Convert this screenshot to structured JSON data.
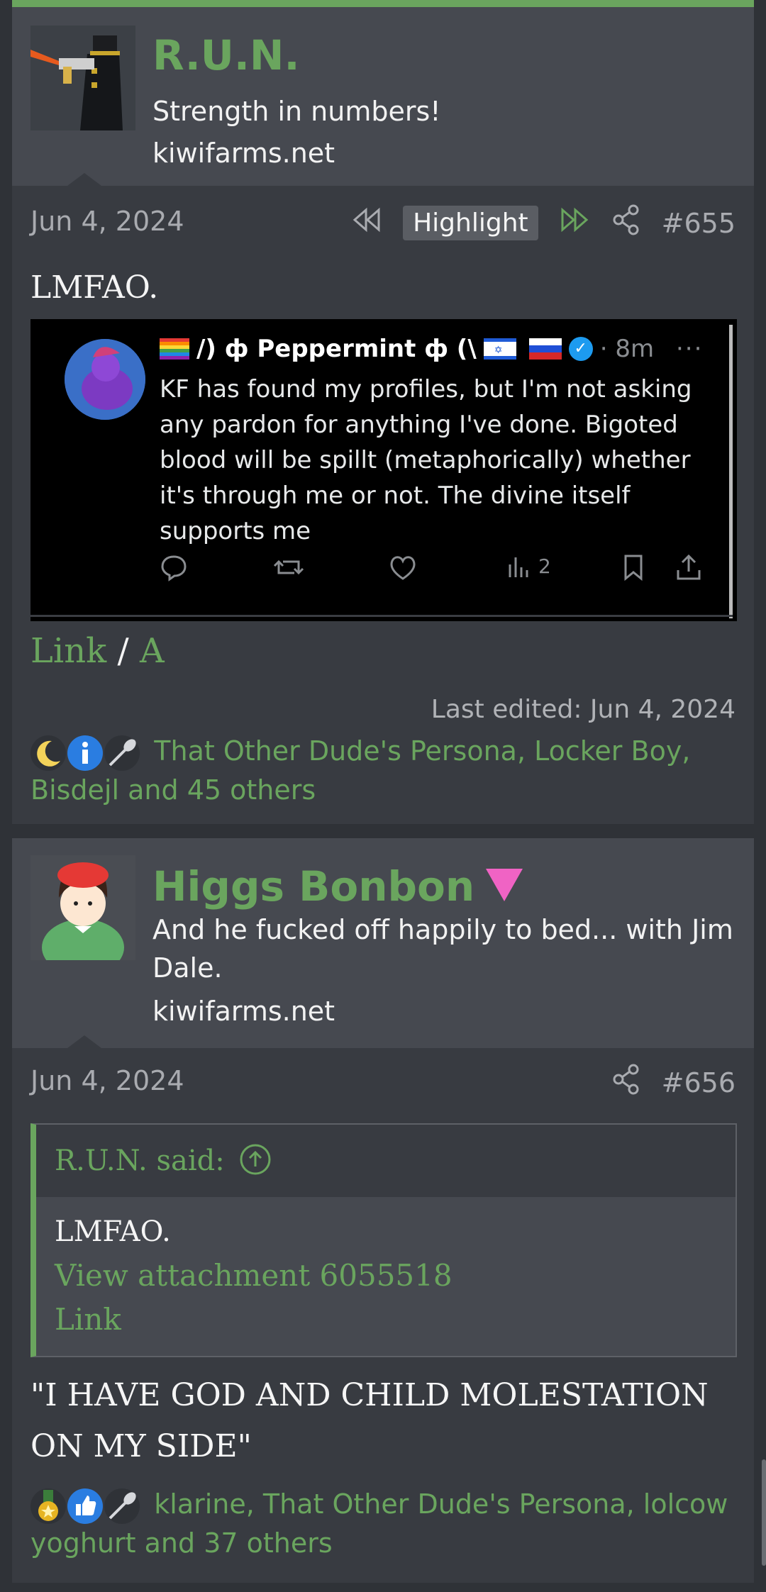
{
  "post1": {
    "username": "R.U.N.",
    "user_title": "Strength in numbers!",
    "user_site": "kiwifarms.net",
    "date": "Jun 4, 2024",
    "highlight_label": "Highlight",
    "post_number": "#655",
    "body": "LMFAO.",
    "embed": {
      "display_name": "/) ф Peppermint ф (\\",
      "time": "· 8m",
      "text": "KF has found my profiles, but I'm not asking any pardon for anything I've done. Bigoted blood will be spillt (metaphorically) whether it's through me or not. The divine itself supports me",
      "view_count": "2"
    },
    "link_label": "Link",
    "link_sep": "/",
    "archive_label": "A",
    "last_edited": "Last edited: Jun 4, 2024",
    "reactions_text": "That Other Dude's Persona, Locker Boy, Bisdejl and 45 others"
  },
  "post2": {
    "username": "Higgs Bonbon",
    "user_title": "And he fucked off happily to bed... with Jim Dale.",
    "user_site": "kiwifarms.net",
    "date": "Jun 4, 2024",
    "post_number": "#656",
    "quote": {
      "header": "R.U.N. said:",
      "line1": "LMFAO.",
      "line2": "View attachment 6055518",
      "line3": "Link"
    },
    "body": "\"I HAVE GOD AND CHILD MOLESTATION ON MY SIDE\"",
    "reactions_text": "klarine, That Other Dude's Persona, lolcow yoghurt and 37 others"
  },
  "colors": {
    "accent": "#6aa55e",
    "post_bg": "#383b41",
    "header_bg": "#464950",
    "page_bg": "#2f3237"
  }
}
